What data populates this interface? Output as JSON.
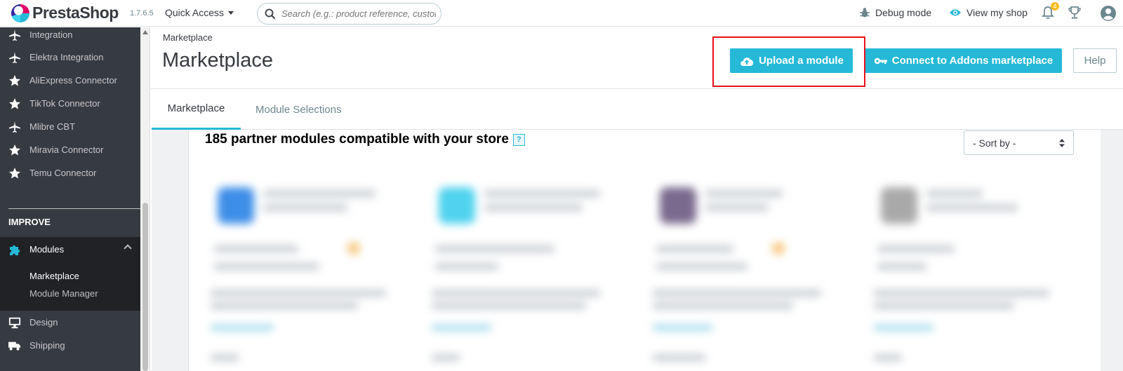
{
  "header": {
    "brand": "PrestaShop",
    "version": "1.7.6.5",
    "quick_access": "Quick Access",
    "search_placeholder": "Search (e.g.: product reference, customer name…)",
    "debug_mode": "Debug mode",
    "view_my_shop": "View my shop",
    "notifications_count": "4"
  },
  "sidebar": {
    "items": [
      {
        "label": "Integration",
        "icon": "plane-icon"
      },
      {
        "label": "Elektra Integration",
        "icon": "plane-icon"
      },
      {
        "label": "AliExpress Connector",
        "icon": "star-icon"
      },
      {
        "label": "TikTok Connector",
        "icon": "star-icon"
      },
      {
        "label": "Mlibre CBT",
        "icon": "plane-icon"
      },
      {
        "label": "Miravia Connector",
        "icon": "star-icon"
      },
      {
        "label": "Temu Connector",
        "icon": "star-icon"
      }
    ],
    "section_title": "IMPROVE",
    "modules_label": "Modules",
    "submenu": [
      "Marketplace",
      "Module Manager"
    ],
    "bottom_items": [
      {
        "label": "Design",
        "icon": "monitor-icon"
      },
      {
        "label": "Shipping",
        "icon": "truck-icon"
      }
    ]
  },
  "page": {
    "breadcrumb": "Marketplace",
    "title": "Marketplace",
    "upload_button": "Upload a module",
    "connect_button": "Connect to Addons marketplace",
    "help_button": "Help"
  },
  "tabs": [
    "Marketplace",
    "Module Selections"
  ],
  "content": {
    "modules_count_text": "185 partner modules compatible with your store",
    "help_mark": "?",
    "sort_label": "- Sort by -"
  },
  "colors": {
    "accent": "#25b9d7",
    "sidebar_bg": "#363a41",
    "highlight": "#e8101a"
  }
}
